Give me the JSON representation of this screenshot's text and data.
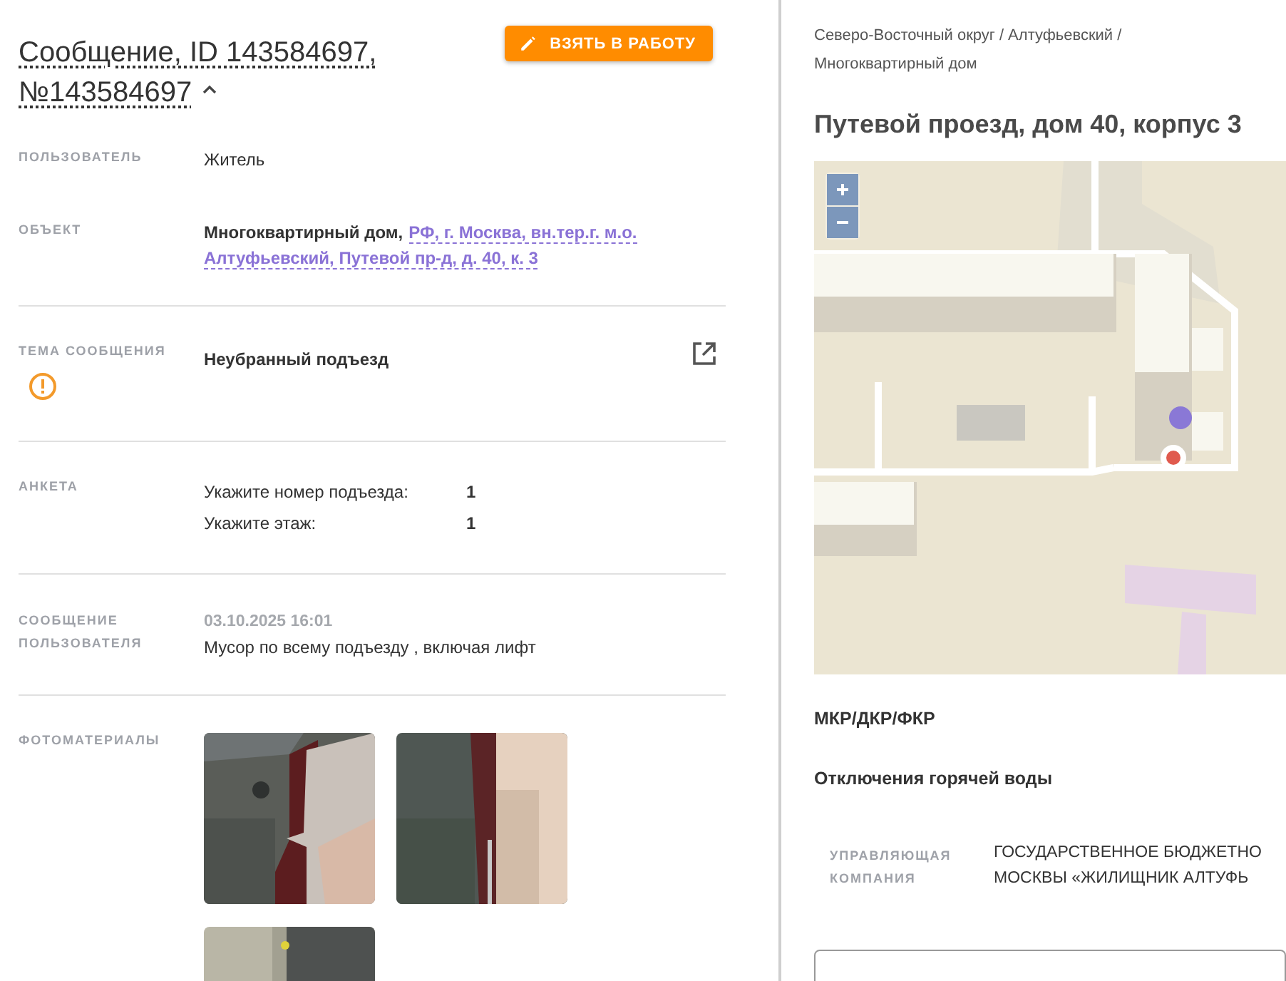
{
  "message": {
    "title_lines": [
      "Сообщение, ID 143584697,",
      "№143584697"
    ],
    "expanded": true,
    "action_button": "ВЗЯТЬ В РАБОТУ"
  },
  "sections": [
    [
      {
        "kind": "text",
        "label": "ПОЛЬЗОВАТЕЛЬ",
        "value": "Житель"
      },
      {
        "kind": "object",
        "label": "ОБЪЕКТ",
        "value": "Многоквартирный дом,",
        "link_lines": [
          "РФ, г. Москва, вн.тер.г. м.о.",
          "Алтуфьевский, Путевой пр-д, д. 40, к. 3"
        ]
      }
    ],
    [
      {
        "kind": "topic",
        "label": "ТЕМА СООБЩЕНИЯ",
        "value": "Неубранный подъезд",
        "warning": true
      }
    ],
    [
      {
        "kind": "survey",
        "label": "АНКЕТА",
        "answers": [
          {
            "question": "Укажите номер подъезда:",
            "answer": "1"
          },
          {
            "question": "Укажите этаж:",
            "answer": "1"
          }
        ]
      }
    ],
    [
      {
        "kind": "message",
        "label": "СООБЩЕНИЕ ПОЛЬЗОВАТЕЛЯ",
        "time": "03.10.2025 16:01",
        "value": "Мусор по всему подъезду , включая лифт"
      }
    ],
    [
      {
        "kind": "photos",
        "label": "ФОТОМАТЕРИАЛЫ",
        "photos": [
          {
            "kind": "picture"
          },
          {
            "kind": "picture"
          },
          {
            "kind": "picture"
          }
        ]
      }
    ]
  ],
  "location": {
    "breadcrumb": "Северо-Восточный округ / Алтуфьевский / Многоквартирный дом",
    "address": "Путевой проезд, дом 40, корпус 3",
    "map": {
      "kind": "picture"
    },
    "notes": [
      "МКР/ДКР/ФКР",
      "Отключения горячей воды"
    ],
    "management": {
      "label": "УПРАВЛЯЮЩАЯ КОМПАНИЯ",
      "value_lines": [
        "ГОСУДАРСТВЕННОЕ БЮДЖЕТНО",
        "МОСКВЫ «ЖИЛИЩНИК АЛТУФЬ"
      ]
    }
  }
}
